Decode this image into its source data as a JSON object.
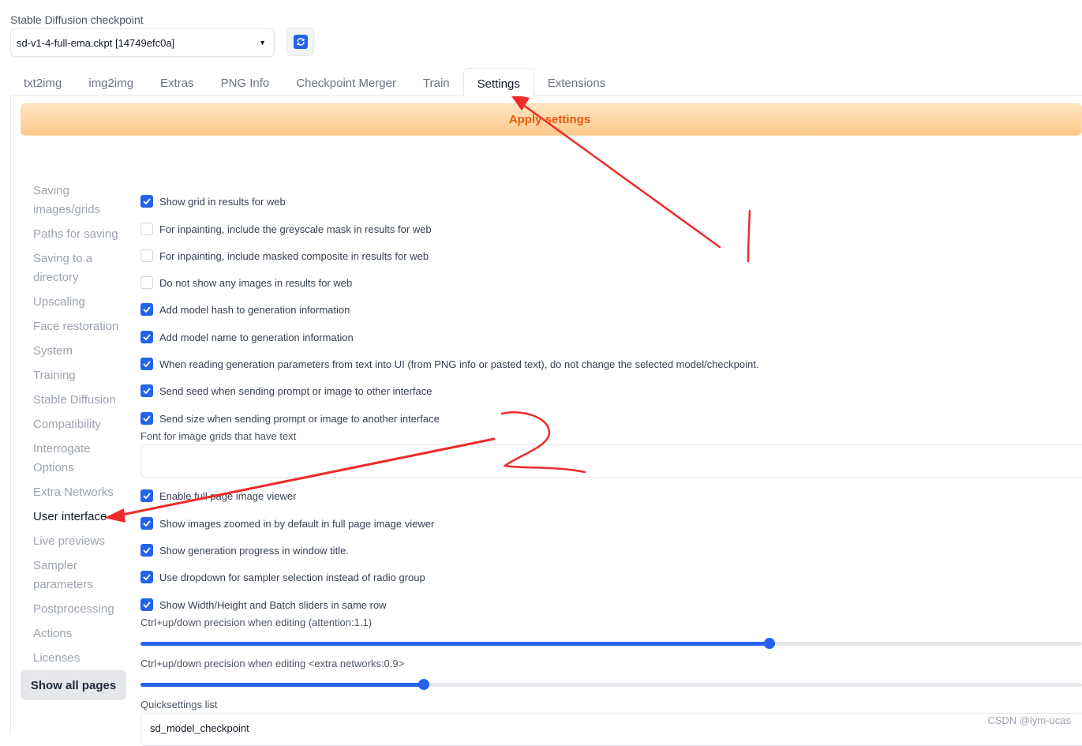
{
  "checkpoint": {
    "label": "Stable Diffusion checkpoint",
    "value": "sd-v1-4-full-ema.ckpt [14749efc0a]"
  },
  "tabs": [
    {
      "label": "txt2img"
    },
    {
      "label": "img2img"
    },
    {
      "label": "Extras"
    },
    {
      "label": "PNG Info"
    },
    {
      "label": "Checkpoint Merger"
    },
    {
      "label": "Train"
    },
    {
      "label": "Settings"
    },
    {
      "label": "Extensions"
    }
  ],
  "active_tab": "Settings",
  "apply_button": "Apply settings",
  "sidebar": {
    "items": [
      {
        "label": "Saving images/grids"
      },
      {
        "label": "Paths for saving"
      },
      {
        "label": "Saving to a directory"
      },
      {
        "label": "Upscaling"
      },
      {
        "label": "Face restoration"
      },
      {
        "label": "System"
      },
      {
        "label": "Training"
      },
      {
        "label": "Stable Diffusion"
      },
      {
        "label": "Compatibility"
      },
      {
        "label": "Interrogate Options"
      },
      {
        "label": "Extra Networks"
      },
      {
        "label": "User interface"
      },
      {
        "label": "Live previews"
      },
      {
        "label": "Sampler parameters"
      },
      {
        "label": "Postprocessing"
      },
      {
        "label": "Actions"
      },
      {
        "label": "Licenses"
      }
    ],
    "active_item": "User interface",
    "show_all": "Show all pages"
  },
  "settings": {
    "checkboxes_top": [
      {
        "label": "Show grid in results for web",
        "checked": true
      },
      {
        "label": "For inpainting, include the greyscale mask in results for web",
        "checked": false
      },
      {
        "label": "For inpainting, include masked composite in results for web",
        "checked": false
      },
      {
        "label": "Do not show any images in results for web",
        "checked": false
      },
      {
        "label": "Add model hash to generation information",
        "checked": true
      },
      {
        "label": "Add model name to generation information",
        "checked": true
      },
      {
        "label": "When reading generation parameters from text into UI (from PNG info or pasted text), do not change the selected model/checkpoint.",
        "checked": true
      },
      {
        "label": "Send seed when sending prompt or image to other interface",
        "checked": true
      },
      {
        "label": "Send size when sending prompt or image to another interface",
        "checked": true
      }
    ],
    "font_field": {
      "label": "Font for image grids that have text",
      "value": ""
    },
    "checkboxes_bottom": [
      {
        "label": "Enable full page image viewer",
        "checked": true
      },
      {
        "label": "Show images zoomed in by default in full page image viewer",
        "checked": true
      },
      {
        "label": "Show generation progress in window title.",
        "checked": true
      },
      {
        "label": "Use dropdown for sampler selection instead of radio group",
        "checked": true
      },
      {
        "label": "Show Width/Height and Batch sliders in same row",
        "checked": true
      }
    ],
    "slider_attention": {
      "label": "Ctrl+up/down precision when editing (attention:1.1)",
      "fraction": 0.668
    },
    "slider_extra": {
      "label": "Ctrl+up/down precision when editing <extra networks:0.9>",
      "fraction": 0.301
    },
    "quicksettings": {
      "label": "Quicksettings list",
      "value": "sd_model_checkpoint"
    }
  },
  "watermark": "CSDN @lym-ucas",
  "annotation_color": "#ef2b2b",
  "accent_color": "#2563eb",
  "apply_text_color": "#ea580c"
}
